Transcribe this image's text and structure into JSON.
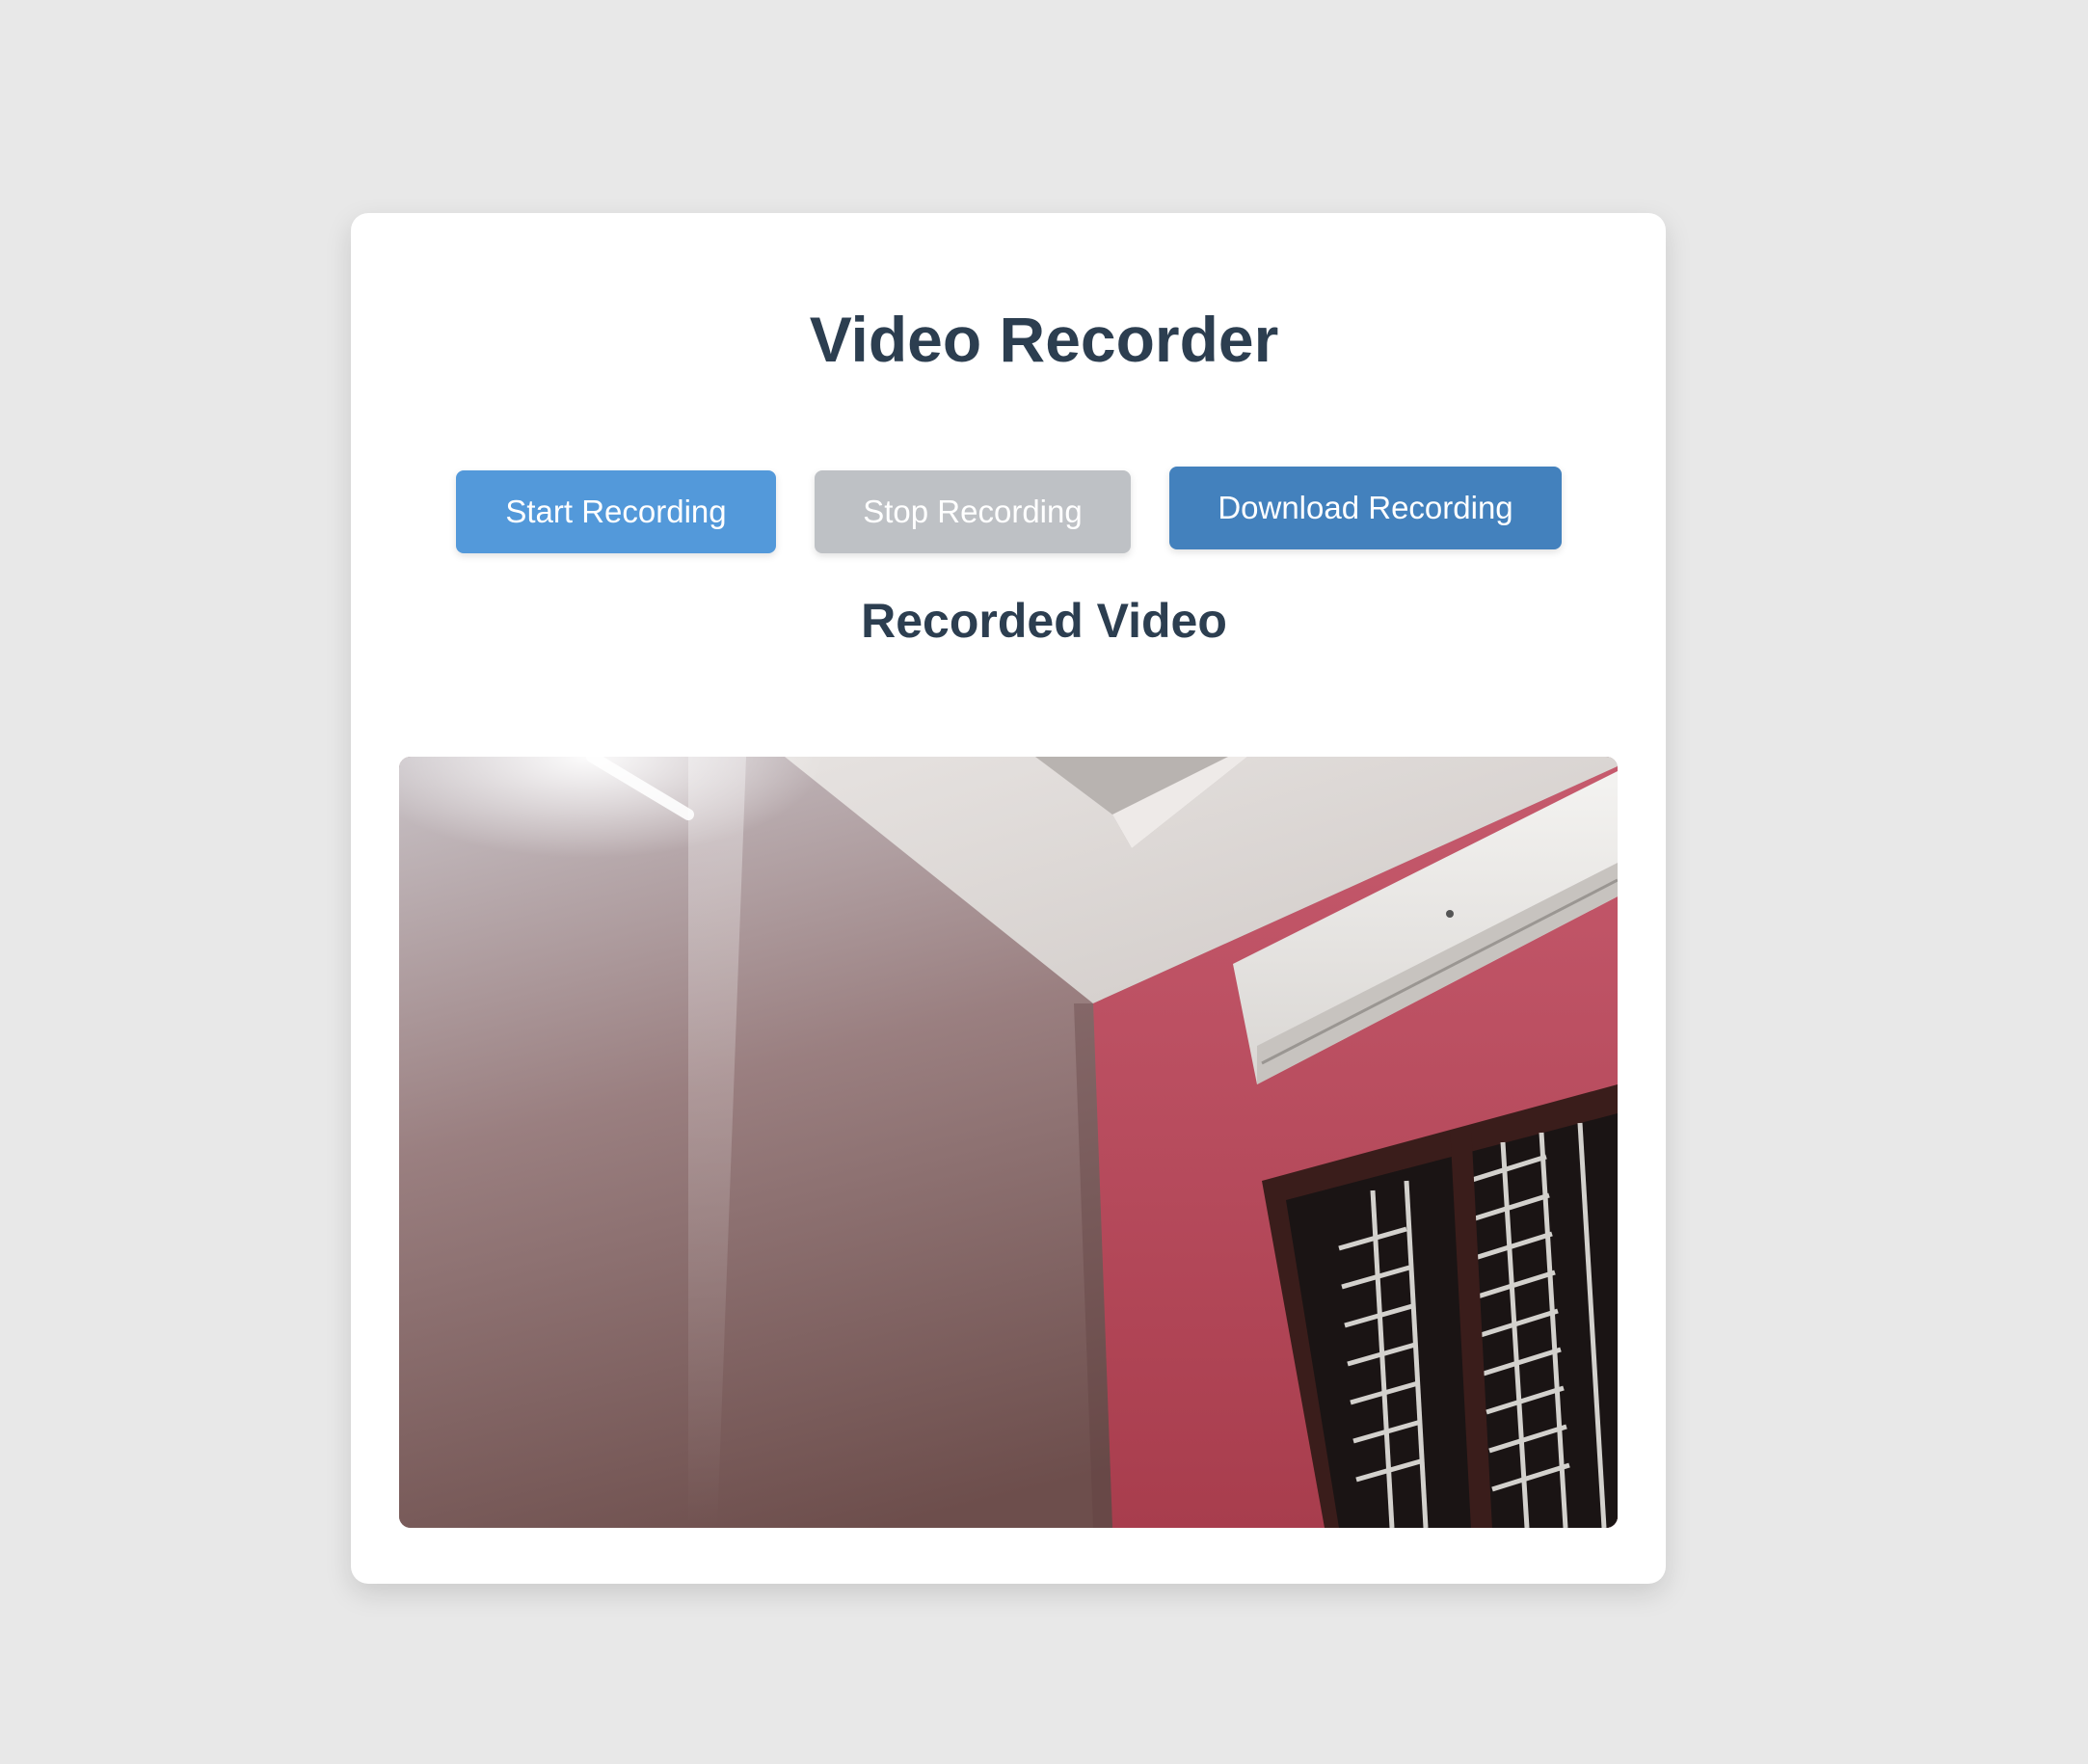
{
  "app": {
    "title": "Video Recorder"
  },
  "controls": {
    "start_label": "Start Recording",
    "stop_label": "Stop Recording",
    "download_label": "Download Recording",
    "stop_disabled": true
  },
  "playback": {
    "heading": "Recorded Video"
  },
  "colors": {
    "page_background": "#e8e8e8",
    "card_background": "#ffffff",
    "heading_text": "#2c3e50",
    "start_button": "#5399da",
    "stop_button_disabled": "#bec1c5",
    "download_button": "#4381bd"
  }
}
